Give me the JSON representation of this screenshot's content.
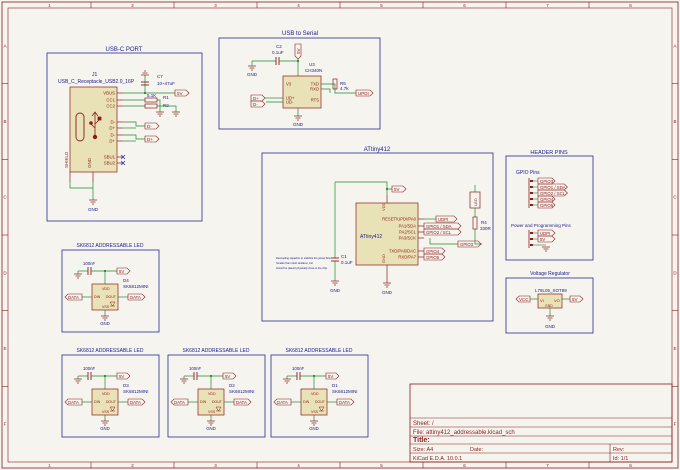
{
  "frame": {
    "col_labels": [
      "1",
      "2",
      "3",
      "4",
      "5",
      "6",
      "7",
      "8"
    ],
    "row_labels": [
      "A",
      "B",
      "C",
      "D",
      "E",
      "F"
    ]
  },
  "title_block": {
    "sheet": "Sheet: /",
    "file": "File: attiny412_addressable.kicad_sch",
    "title": "Title:",
    "size": "Size: A4",
    "date": "Date:",
    "rev": "Rev:",
    "kicad": "KiCad E.D.A. 10.0.1",
    "id": "Id: 1/1"
  },
  "usbc": {
    "title": "USB-C PORT",
    "ref": "J1",
    "value": "USB_C_Receptacle_USB2.0_16P",
    "pins_right": [
      "VBUS",
      "CC1",
      "CC2",
      "D-",
      "D+",
      "D-",
      "D+",
      "SBU1",
      "SBU2"
    ],
    "pins_left": [
      "SHIELD",
      "GND"
    ],
    "c7_ref": "C7",
    "c7_value": "10~47uF",
    "r1_ref": "R1",
    "r1_value": "5.1K",
    "r2_ref": "R2",
    "r2_value": "5.1K",
    "label_5v": "5V",
    "label_dminus": "D-",
    "label_dplus": "D+",
    "gnd": "GND"
  },
  "usb_serial": {
    "title": "USB to Serial",
    "c2_ref": "C2",
    "c2_value": "0.1uF",
    "u3_ref": "U3",
    "u3_value": "CH340N",
    "pins_left": [
      "V3",
      "UD+",
      "UD-"
    ],
    "pins_right": [
      "TXD",
      "RXD",
      "RTS"
    ],
    "r5_ref": "R5",
    "r5_value": "4.7k",
    "label_5v": "5V",
    "label_dminus": "D-",
    "label_dplus": "D+",
    "label_updi": "UPDI",
    "gnd": "GND"
  },
  "attiny": {
    "title": "ATtiny412",
    "chip": "ATtiny412",
    "pins": [
      "RESET/UPDI/PA0",
      "PA1/SDA",
      "PA2/SCL",
      "PA3/SCK",
      "TXD/PA6/DAC",
      "RXD/PA7"
    ],
    "vdd": "VDD",
    "gnd_pin": "GND",
    "c1_ref": "C1",
    "c1_value": "0.1uF",
    "r4_ref": "R4",
    "r4_value": "330R",
    "d_ref": "D",
    "d_value": "LED",
    "labels": [
      "UDPI",
      "GPIO1 / SDA",
      "GPIO2 / SCL",
      "GPIO3",
      "GPIO4",
      "GPIO5"
    ],
    "label_5v": "5V",
    "note_lines": [
      "Decoupling capacitor to stabilize the power flow.",
      "Smaller than 10uF tantalum, but",
      "should be placed physically close to the chip."
    ],
    "gnd": "GND"
  },
  "header": {
    "title": "HEADER PINS",
    "gpio_title": "GPIO Pins",
    "gpio_labels": [
      "GPIO3",
      "GPIO1 / SDA",
      "GPIO2 / SCL",
      "GPIO4",
      "GPIO5"
    ],
    "prog_title": "Power and Programming Pins",
    "prog_labels": [
      "UDPI",
      "5V",
      "GND"
    ]
  },
  "regulator": {
    "title": "Voltage  Regulator",
    "part": "L78L05_SOT89",
    "pins": [
      "VI",
      "VO",
      "GND"
    ],
    "label_vcc": "VCC",
    "label_5v": "5V",
    "gnd": "GND"
  },
  "leds": [
    {
      "title": "SK6812 ADDRESSABLE LED",
      "ref": "D4",
      "value": "SK6812MINI",
      "cap_value": "100nF",
      "cap_ref": "C6",
      "label_5v": "5V",
      "data_in": "DATA",
      "data_out": "DATA",
      "pins": [
        "VDD",
        "DIN",
        "DOUT",
        "VSS"
      ],
      "gnd": "GND"
    },
    {
      "title": "SK6812 ADDRESSABLE LED",
      "ref": "D3",
      "value": "SK6812MINI",
      "cap_value": "100nF",
      "cap_ref": "C5",
      "label_5v": "5V",
      "data_in": "DATA",
      "data_out": "DATA",
      "pins": [
        "VDD",
        "DIN",
        "DOUT",
        "VSS"
      ],
      "gnd": "GND"
    },
    {
      "title": "SK6812 ADDRESSABLE LED",
      "ref": "D2",
      "value": "SK6812MINI",
      "cap_value": "100nF",
      "cap_ref": "C4",
      "label_5v": "5V",
      "data_in": "DATA",
      "data_out": "DATA",
      "pins": [
        "VDD",
        "DIN",
        "DOUT",
        "VSS"
      ],
      "gnd": "GND"
    },
    {
      "title": "SK6812 ADDRESSABLE LED",
      "ref": "D1",
      "value": "SK6812MINI",
      "cap_value": "100nF",
      "cap_ref": "C3",
      "label_5v": "5V",
      "data_in": "DATA",
      "data_out": "DATA",
      "pins": [
        "VDD",
        "DIN",
        "DOUT",
        "VSS"
      ],
      "gnd": "GND"
    }
  ],
  "colors": {
    "frame": "#8b1c1c",
    "box": "#2a2a8f",
    "wire": "#1e8a2e",
    "body": "#e9e2b6",
    "part": "#8b1c1c",
    "text": "#1a1a8a",
    "label": "#8b1c1c"
  }
}
